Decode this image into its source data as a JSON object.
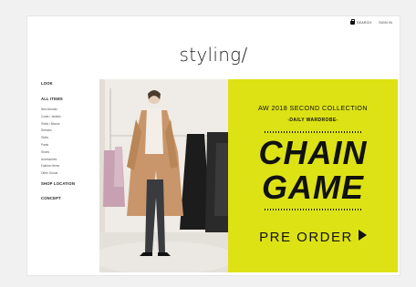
{
  "header": {
    "search_label": "SEARCH",
    "signin_label": "SIGN IN"
  },
  "brand": {
    "logo": "styling/"
  },
  "sidebar": {
    "look": "LOOK",
    "all_items": "ALL ITEMS",
    "categories": [
      "New Arrivals",
      "Coats / Jackets",
      "Shirts / Blouse",
      "Dresses",
      "Skirts",
      "Pants",
      "Shoes",
      "Accessories",
      "Fashion Items",
      "Other Goods"
    ],
    "shop_location": "SHOP LOCATION",
    "concept": "CONCEPT"
  },
  "banner": {
    "line1": "AW 2018 SECOND COLLECTION",
    "line2": "-DAILY WARDROBE-",
    "title_line1": "CHAIN",
    "title_line2": "GAME",
    "cta": "PRE ORDER"
  },
  "colors": {
    "banner_panel": "#dde215",
    "page_bg": "#ffffff",
    "outer_bg": "#f1f1f1"
  }
}
